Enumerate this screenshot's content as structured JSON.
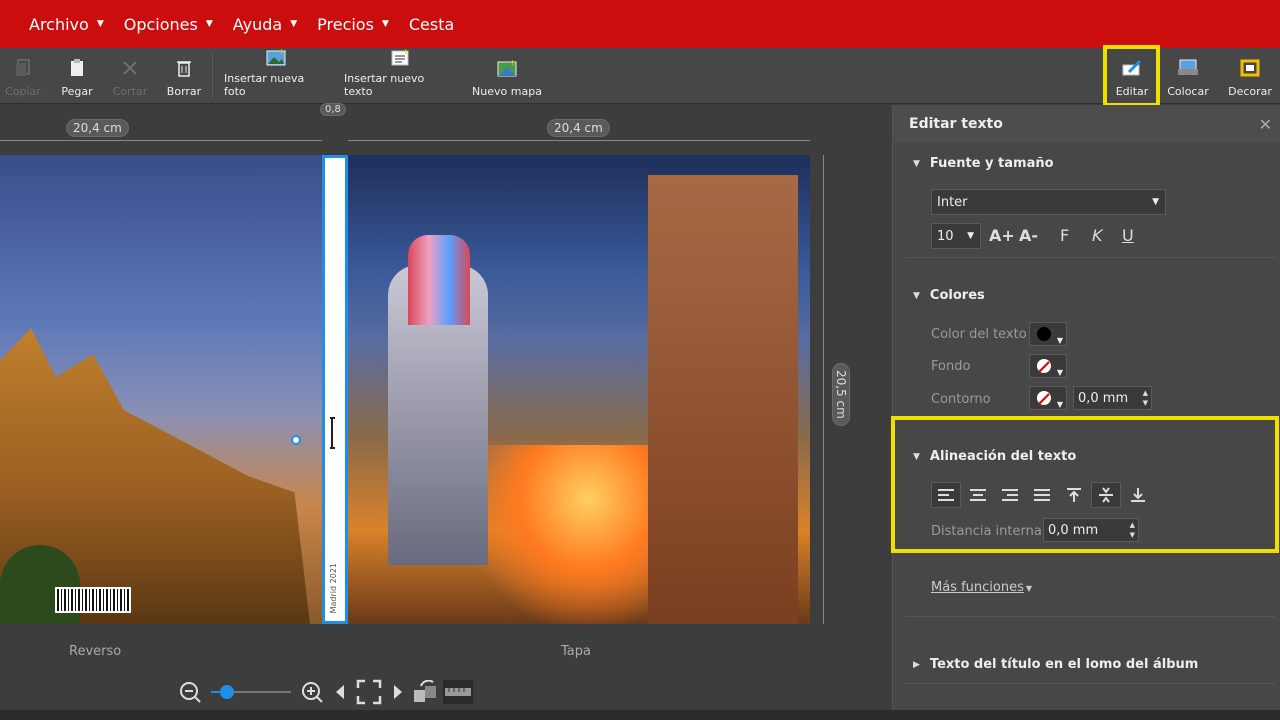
{
  "menu": {
    "items": [
      {
        "label": "Archivo",
        "has_caret": true
      },
      {
        "label": "Opciones",
        "has_caret": true
      },
      {
        "label": "Ayuda",
        "has_caret": true
      },
      {
        "label": "Precios",
        "has_caret": true
      },
      {
        "label": "Cesta",
        "has_caret": false
      }
    ]
  },
  "toolbar": {
    "copy": "Copiar",
    "paste": "Pegar",
    "cut": "Cortar",
    "delete": "Borrar",
    "insert_photo": "Insertar nueva foto",
    "insert_text": "Insertar nuevo texto",
    "new_map": "Nuevo mapa",
    "edit": "Editar",
    "place": "Colocar",
    "decorate": "Decorar"
  },
  "workspace": {
    "dim_left": "20,4 cm",
    "dim_spine": "0,8",
    "dim_right": "20,4 cm",
    "dim_height": "20,5 cm",
    "spine_text": "Madrid 2021",
    "back_label": "Reverso",
    "front_label": "Tapa",
    "zoom_level": 0.2
  },
  "panel": {
    "title": "Editar texto",
    "close": "✕",
    "font_section": "Fuente y tamaño",
    "font_family": "Inter",
    "font_size": "10",
    "grow_font": "A+",
    "shrink_font": "A-",
    "bold": "F",
    "italic": "K",
    "underline": "U",
    "colors_section": "Colores",
    "text_color_label": "Color del texto",
    "background_label": "Fondo",
    "outline_label": "Contorno",
    "outline_value": "0,0 mm",
    "align_section": "Alineación del texto",
    "inner_distance_label": "Distancia interna",
    "inner_distance_value": "0,0 mm",
    "more_functions": "Más funciones",
    "spine_title_section": "Texto del título en el lomo del álbum"
  },
  "colors": {
    "menubar": "#cc0d0d",
    "highlight": "#f0e000",
    "selection": "#1e8fe8",
    "text_color": "#000000"
  }
}
